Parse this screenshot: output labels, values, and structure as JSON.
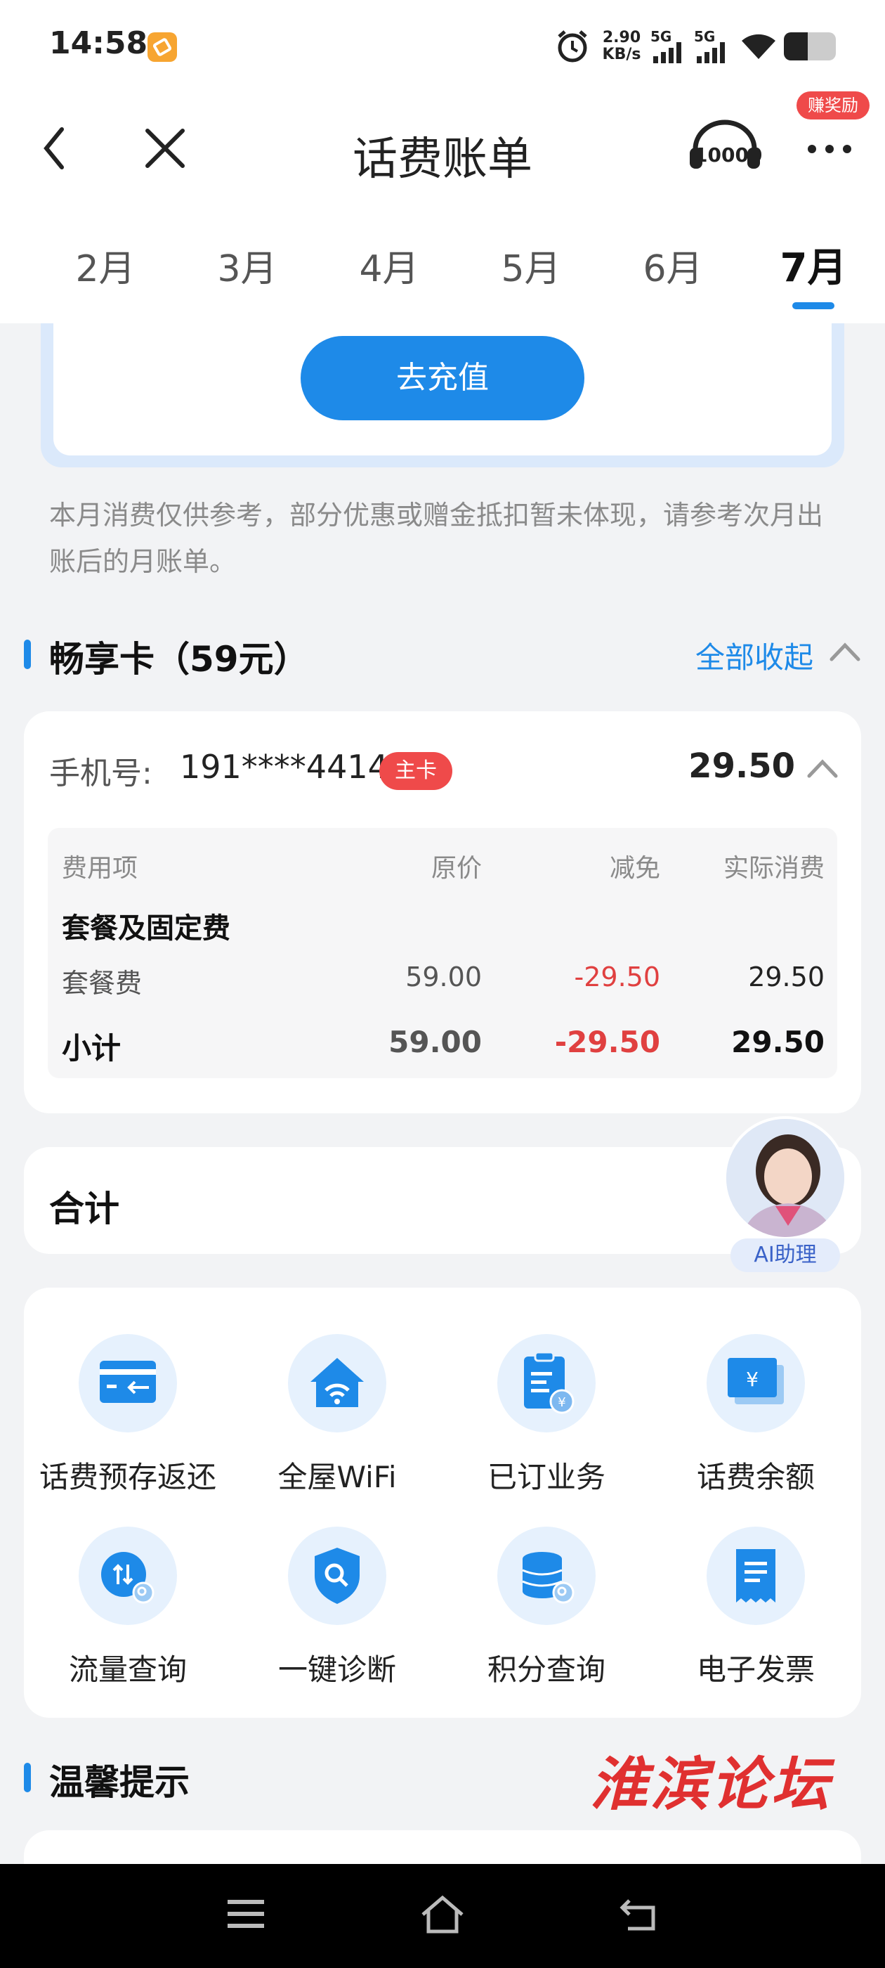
{
  "status_bar": {
    "time": "14:58",
    "net_speed_value": "2.90",
    "net_speed_unit": "KB/s",
    "sim1": "5G",
    "sim2": "5G"
  },
  "header": {
    "title": "话费账单",
    "reward_badge": "赚奖励",
    "service_number": "10000"
  },
  "tabs": [
    {
      "label": "2月",
      "active": false
    },
    {
      "label": "3月",
      "active": false
    },
    {
      "label": "4月",
      "active": false
    },
    {
      "label": "5月",
      "active": false
    },
    {
      "label": "6月",
      "active": false
    },
    {
      "label": "7月",
      "active": true
    }
  ],
  "recharge_button": "去充值",
  "note": "本月消费仅供参考，部分优惠或赠金抵扣暂未体现，请参考次月出账后的月账单。",
  "plan_section": {
    "title": "畅享卡（59元）",
    "collapse_label": "全部收起"
  },
  "phone_card": {
    "label": "手机号:",
    "number": "191****4414",
    "badge": "主卡",
    "amount": "29.50"
  },
  "bill_table": {
    "headers": [
      "费用项",
      "原价",
      "减免",
      "实际消费"
    ],
    "group_title": "套餐及固定费",
    "rows": [
      {
        "item": "套餐费",
        "original": "59.00",
        "discount": "-29.50",
        "actual": "29.50"
      }
    ],
    "subtotal": {
      "item": "小计",
      "original": "59.00",
      "discount": "-29.50",
      "actual": "29.50"
    }
  },
  "total": {
    "label": "合计"
  },
  "ai_assistant": {
    "label": "AI助理"
  },
  "services": [
    {
      "label": "话费预存返还",
      "icon": "card-return-icon"
    },
    {
      "label": "全屋WiFi",
      "icon": "home-wifi-icon"
    },
    {
      "label": "已订业务",
      "icon": "clipboard-icon"
    },
    {
      "label": "话费余额",
      "icon": "balance-icon"
    },
    {
      "label": "流量查询",
      "icon": "data-query-icon"
    },
    {
      "label": "一键诊断",
      "icon": "shield-search-icon"
    },
    {
      "label": "积分查询",
      "icon": "points-icon"
    },
    {
      "label": "电子发票",
      "icon": "invoice-icon"
    }
  ],
  "tips_section": {
    "title": "温馨提示"
  },
  "watermark": "淮滨论坛",
  "colors": {
    "accent": "#1e8ae8",
    "danger": "#e04040",
    "background": "#f2f3f5"
  }
}
